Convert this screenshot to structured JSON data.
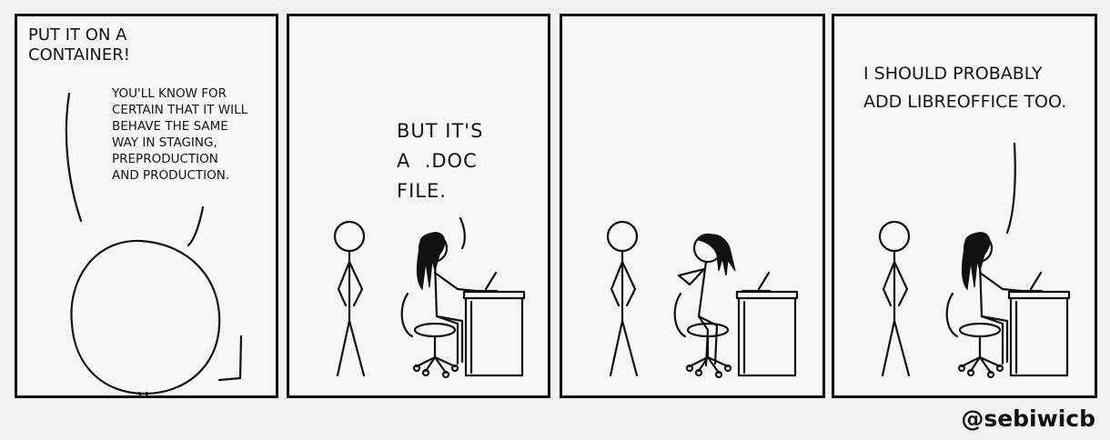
{
  "comic": {
    "panels": [
      {
        "speech": [
          "PUT IT ON A\nCONTAINER!",
          "YOU'LL KNOW FOR\nCERTAIN THAT IT WILL\nBEHAVE THE SAME\nWAY IN STAGING,\nPREPRODUCTION\nAND PRODUCTION."
        ]
      },
      {
        "speech": [
          "BUT IT'S\nA  .DOC\nFILE."
        ]
      },
      {
        "speech": []
      },
      {
        "speech": [
          "I SHOULD PROBABLY\nADD LIBREOFFICE TOO."
        ]
      }
    ],
    "credit": "@sebiwicb"
  }
}
